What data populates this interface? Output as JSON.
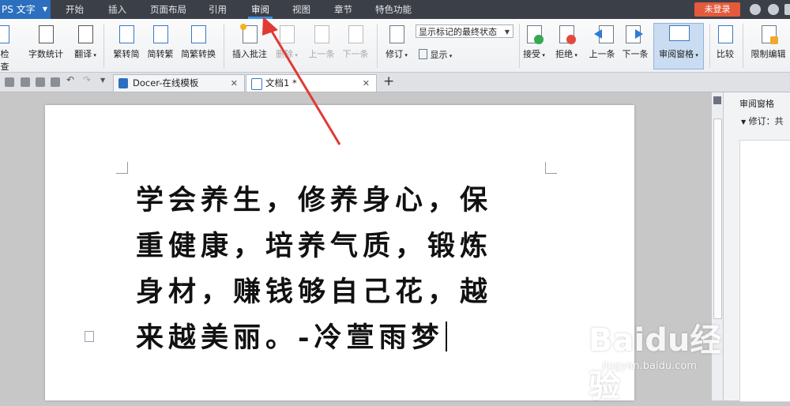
{
  "app": {
    "button_label": "PS 文字"
  },
  "menu": {
    "items": [
      "开始",
      "插入",
      "页面布局",
      "引用",
      "审阅",
      "视图",
      "章节",
      "特色功能"
    ],
    "active": "审阅",
    "login_label": "未登录"
  },
  "ribbon": {
    "spell_label": "检查",
    "wordcount_label": "字数统计",
    "translate_label": "翻译",
    "trad_simp_label": "繁转简",
    "simp_trad_label": "简转繁",
    "convert_label": "简繁转换",
    "insert_comment_label": "插入批注",
    "delete_label": "删除",
    "prev_comment_label": "上一条",
    "next_comment_label": "下一条",
    "revise_label": "修订",
    "markup_select_value": "显示标记的最终状态",
    "show_label": "显示",
    "accept_label": "接受",
    "reject_label": "拒绝",
    "prev_change_label": "上一条",
    "next_change_label": "下一条",
    "review_pane_label": "审阅窗格",
    "compare_label": "比较",
    "restrict_label": "限制编辑"
  },
  "tabs": [
    {
      "label": "Docer-在线模板"
    },
    {
      "label": "文档1 *"
    }
  ],
  "document": {
    "lines": [
      "学会养生，修养身心，保",
      "重健康，培养气质，锻炼",
      "身材，赚钱够自己花，越",
      "来越美丽。-冷萱雨梦"
    ]
  },
  "pane": {
    "title": "审阅窗格",
    "revisions_label": "修订：共"
  },
  "watermark": {
    "logo": "Baidu经验",
    "url": "jingyan.baidu.com"
  },
  "colors": {
    "menubar": "#3b3f48",
    "accent": "#2c6fbf",
    "login": "#e35a3c",
    "arrow": "#e03a33"
  }
}
